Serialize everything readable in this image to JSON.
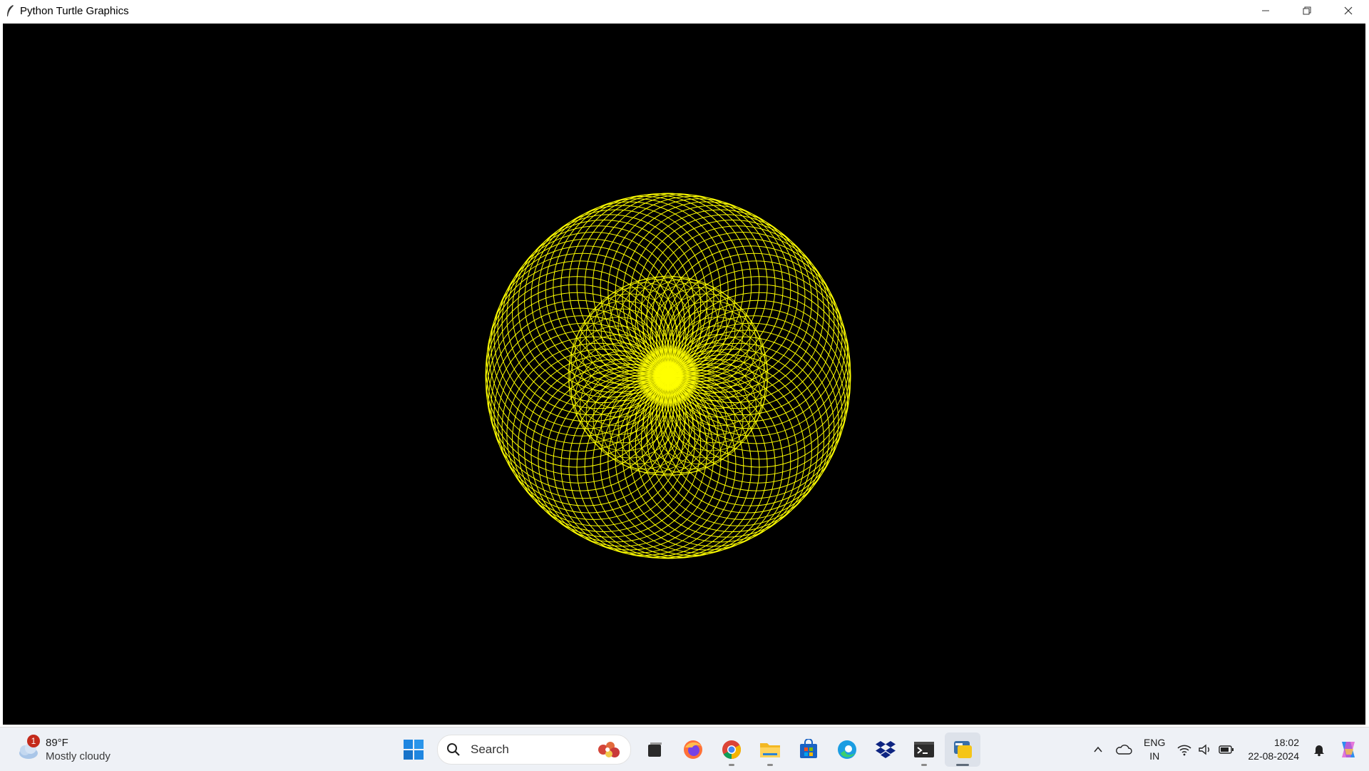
{
  "window": {
    "title": "Python Turtle Graphics",
    "app_icon": "feather-icon",
    "controls": [
      "minimize-icon",
      "restore-icon",
      "close-icon"
    ]
  },
  "canvas": {
    "background": "#000000",
    "pen_color": "#ffff00",
    "drawing": "spirograph"
  },
  "taskbar": {
    "weather": {
      "badge": "1",
      "temperature": "89°F",
      "condition": "Mostly cloudy",
      "icon": "cloud-icon"
    },
    "search": {
      "placeholder": "Search"
    },
    "apps": [
      {
        "name": "start-button",
        "icon": "windows-logo-icon"
      },
      {
        "name": "task-view-button",
        "icon": "task-view-icon"
      },
      {
        "name": "firefox-button",
        "icon": "firefox-icon"
      },
      {
        "name": "chrome-button",
        "icon": "chrome-icon"
      },
      {
        "name": "file-explorer-button",
        "icon": "folder-icon"
      },
      {
        "name": "store-button",
        "icon": "store-icon"
      },
      {
        "name": "edge-button",
        "icon": "edge-icon"
      },
      {
        "name": "dropbox-button",
        "icon": "dropbox-icon"
      },
      {
        "name": "terminal-button",
        "icon": "terminal-icon"
      },
      {
        "name": "python-button",
        "icon": "python-icon"
      }
    ],
    "tray": {
      "language_top": "ENG",
      "language_bottom": "IN",
      "time": "18:02",
      "date": "22-08-2024"
    }
  }
}
